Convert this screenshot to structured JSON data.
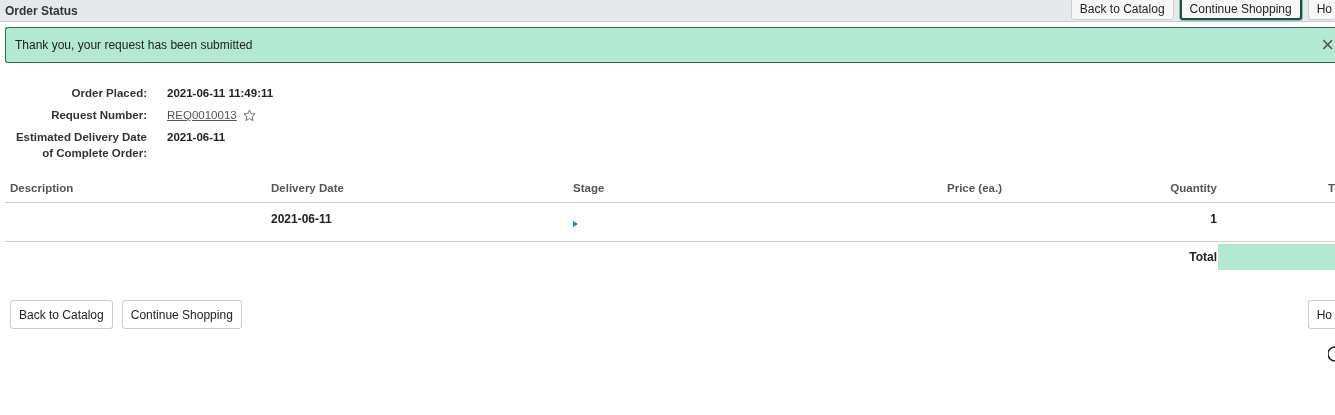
{
  "header": {
    "title": "Order Status",
    "buttons": [
      {
        "label": "Back to Catalog",
        "focused": false
      },
      {
        "label": "Continue Shopping",
        "focused": true
      },
      {
        "label": "Ho",
        "focused": false
      }
    ]
  },
  "alert": {
    "message": "Thank you, your request has been submitted",
    "close": "×"
  },
  "details": [
    {
      "kind": "text",
      "label": "Order Placed:",
      "value": "2021-06-11 11:49:11"
    },
    {
      "kind": "link",
      "label": "Request Number:",
      "value": "REQ0010013",
      "starred": false
    },
    {
      "kind": "text",
      "label": "Estimated Delivery Date of Complete Order:",
      "value": "2021-06-11"
    }
  ],
  "table": {
    "columns": [
      "Description",
      "Delivery Date",
      "Stage",
      "Price (ea.)",
      "Quantity",
      "T"
    ],
    "rows": [
      {
        "delivery_date": "2021-06-11",
        "quantity": "1"
      }
    ],
    "total_label": "Total"
  },
  "footer": {
    "buttons": [
      {
        "label": "Back to Catalog"
      },
      {
        "label": "Continue Shopping"
      },
      {
        "label": "Ho"
      }
    ]
  }
}
